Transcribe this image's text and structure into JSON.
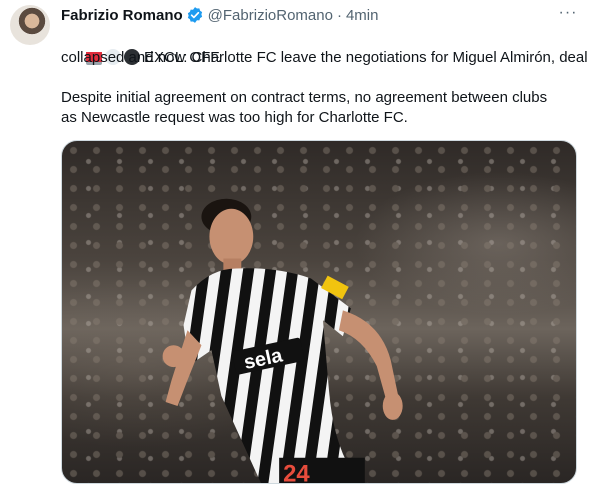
{
  "tweet": {
    "author_name": "Fabrizio Romano",
    "handle": "@FabrizioRomano",
    "separator": "·",
    "time": "4min",
    "more_label": "···",
    "emojis": [
      "siren-emoji",
      "white-circle-emoji",
      "black-circle-emoji"
    ],
    "text_line1": "EXCL: Charlotte FC leave the negotiations for Miguel Almirón, deal",
    "text_line2": "collapsed and now OFF.",
    "text_line3": "Despite initial agreement on contract terms, no agreement between clubs",
    "text_line4": "as Newcastle request was too high for Charlotte FC.",
    "media": {
      "shirt_sponsor": "sela",
      "shirt_number": "24"
    }
  },
  "colors": {
    "verified": "#1d9bf0",
    "secondary_text": "#536471",
    "primary_text": "#0f1419"
  }
}
